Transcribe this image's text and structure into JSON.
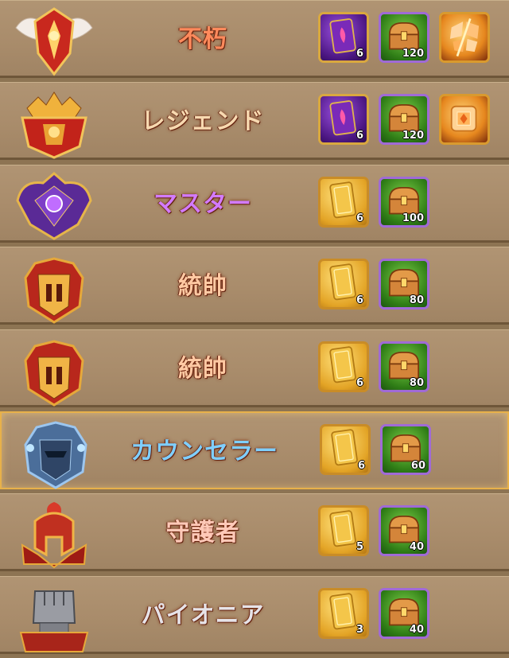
{
  "ranks": [
    {
      "title": "不朽",
      "title_color": "#ff8a5c",
      "emblem_icon": "winged-crest-emblem-icon",
      "rewards": [
        {
          "icon": "purple-card-pack-icon",
          "frame": "purple",
          "qty": "6"
        },
        {
          "icon": "treasure-chest-icon",
          "frame": "green",
          "qty": "120"
        },
        {
          "icon": "shattered-orange-crystal-icon",
          "frame": "orange",
          "qty": ""
        }
      ]
    },
    {
      "title": "レジェンド",
      "title_color": "#f7d9b0",
      "emblem_icon": "crowned-red-crest-emblem-icon",
      "rewards": [
        {
          "icon": "purple-card-pack-icon",
          "frame": "purple",
          "qty": "6"
        },
        {
          "icon": "treasure-chest-icon",
          "frame": "green",
          "qty": "120"
        },
        {
          "icon": "orange-crystal-cube-icon",
          "frame": "orange",
          "qty": ""
        }
      ]
    },
    {
      "title": "マスター",
      "title_color": "#d27bff",
      "emblem_icon": "purple-gem-crest-emblem-icon",
      "rewards": [
        {
          "icon": "gold-card-pack-icon",
          "frame": "gold",
          "qty": "6"
        },
        {
          "icon": "treasure-chest-icon",
          "frame": "green",
          "qty": "100"
        }
      ]
    },
    {
      "title": "統帥",
      "title_color": "#ffc9a3",
      "emblem_icon": "red-gold-helmet-emblem-icon",
      "rewards": [
        {
          "icon": "gold-card-pack-icon",
          "frame": "gold",
          "qty": "6"
        },
        {
          "icon": "treasure-chest-icon",
          "frame": "green",
          "qty": "80"
        }
      ]
    },
    {
      "title": "統帥",
      "title_color": "#ffc9a3",
      "emblem_icon": "red-gold-helmet-emblem-icon",
      "rewards": [
        {
          "icon": "gold-card-pack-icon",
          "frame": "gold",
          "qty": "6"
        },
        {
          "icon": "treasure-chest-icon",
          "frame": "green",
          "qty": "80"
        }
      ]
    },
    {
      "title": "カウンセラー",
      "title_color": "#7fcfff",
      "emblem_icon": "steel-blue-helmet-emblem-icon",
      "rewards": [
        {
          "icon": "gold-card-pack-icon",
          "frame": "gold",
          "qty": "6"
        },
        {
          "icon": "treasure-chest-icon",
          "frame": "green",
          "qty": "60"
        }
      ]
    },
    {
      "title": "守護者",
      "title_color": "#ffc9b8",
      "emblem_icon": "spartan-helmet-emblem-icon",
      "rewards": [
        {
          "icon": "gold-card-pack-icon",
          "frame": "gold",
          "qty": "5"
        },
        {
          "icon": "treasure-chest-icon",
          "frame": "green",
          "qty": "40"
        }
      ]
    },
    {
      "title": "パイオニア",
      "title_color": "#e6e3e8",
      "emblem_icon": "iron-fist-emblem-icon",
      "rewards": [
        {
          "icon": "gold-card-pack-icon",
          "frame": "gold",
          "qty": "3"
        },
        {
          "icon": "treasure-chest-icon",
          "frame": "green",
          "qty": "40"
        }
      ]
    }
  ],
  "highlighted_row": 5
}
